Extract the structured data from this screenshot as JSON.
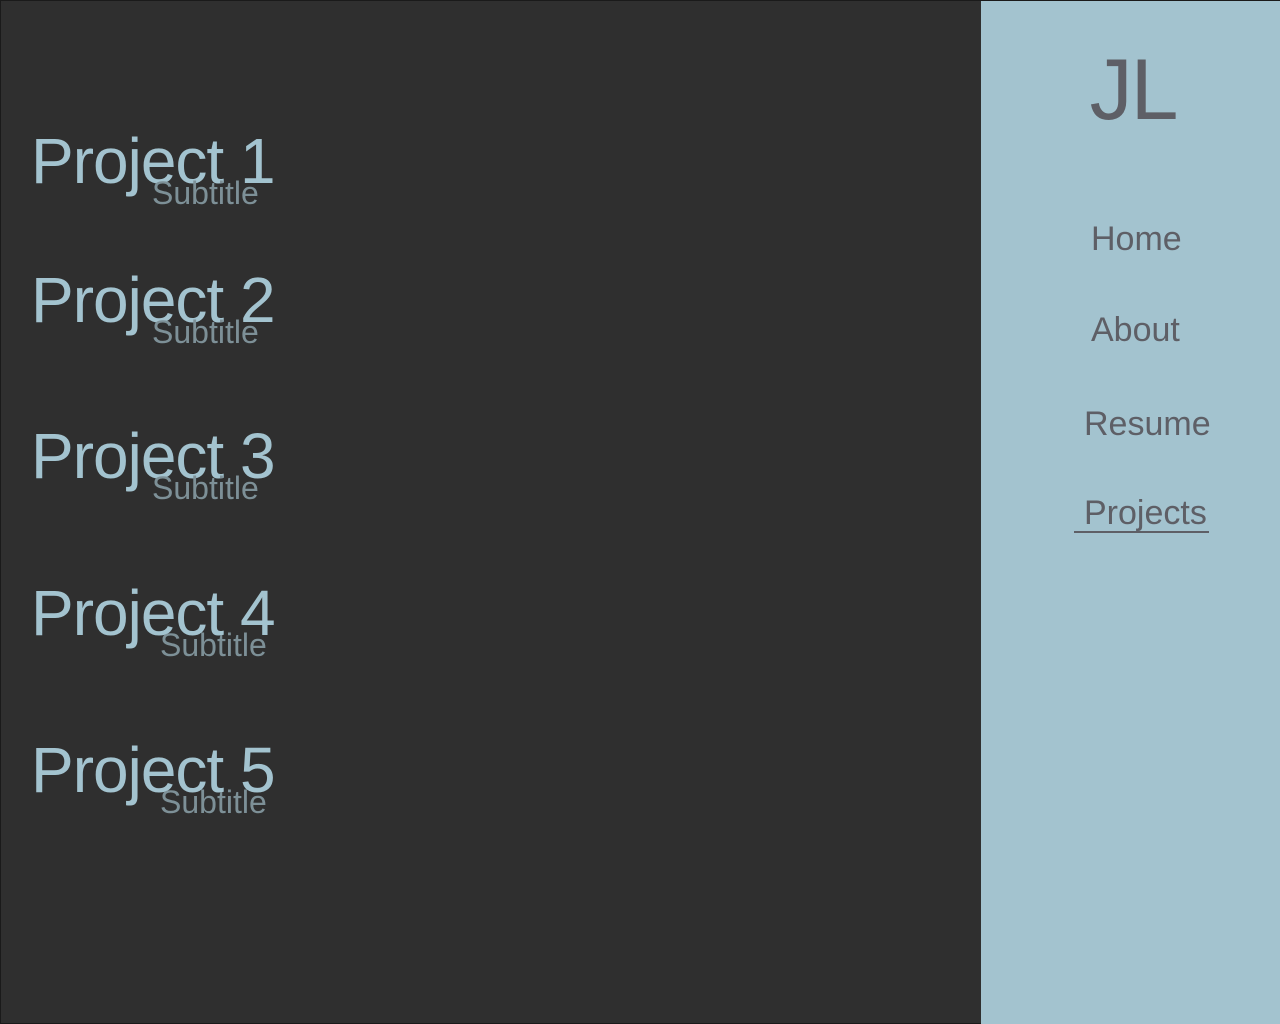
{
  "colors": {
    "background": "#2f2f2f",
    "sidebar": "#a3c3cf",
    "project_title": "#a3c3cf",
    "project_subtitle": "#7d9097",
    "nav_text": "#5e5f66"
  },
  "main": {
    "projects": [
      {
        "title": "Project 1",
        "subtitle": "Subtitle"
      },
      {
        "title": "Project 2",
        "subtitle": "Subtitle"
      },
      {
        "title": "Project 3",
        "subtitle": "Subtitle"
      },
      {
        "title": "Project 4",
        "subtitle": "Subtitle"
      },
      {
        "title": "Project 5",
        "subtitle": "Subtitle"
      }
    ]
  },
  "sidebar": {
    "logo": "JL",
    "nav": [
      {
        "label": "Home"
      },
      {
        "label": "About"
      },
      {
        "label": "Resume"
      },
      {
        "label": "Projects",
        "active": true
      }
    ]
  }
}
